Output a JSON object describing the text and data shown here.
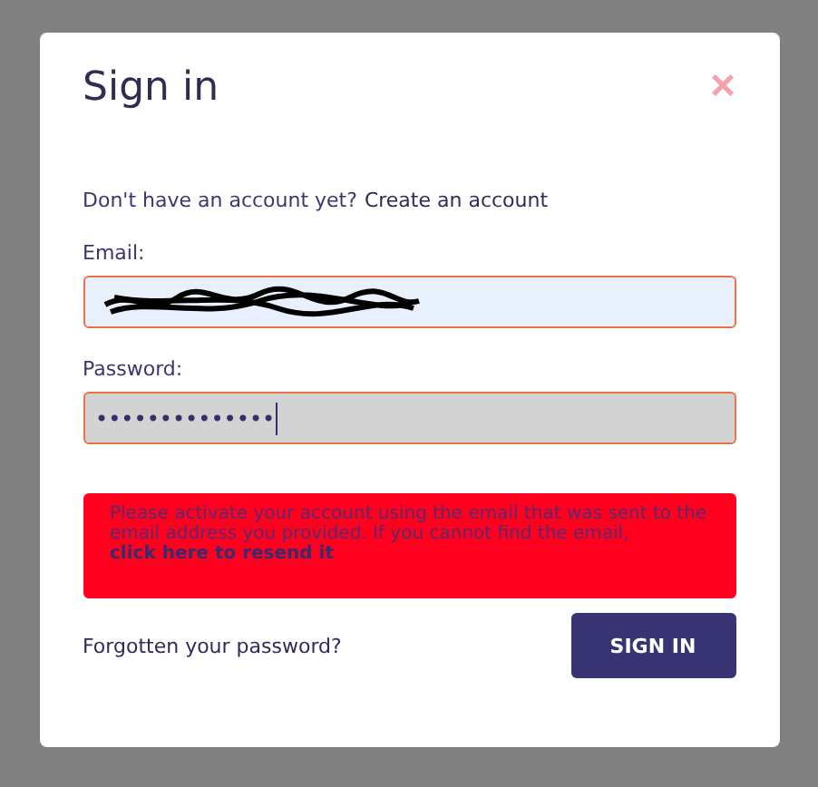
{
  "dialog": {
    "title": "Sign in",
    "close": "×"
  },
  "signup": {
    "prompt": "Don't have an account yet?",
    "link": "Create an account"
  },
  "email": {
    "label": "Email:",
    "redacted": true
  },
  "password": {
    "label": "Password:",
    "value": "••••••••••••••",
    "focused": true
  },
  "error": {
    "text": "Please activate your account using the email that was sent to the email address you provided. If you cannot find the email,",
    "link": "click here to resend it"
  },
  "forgot": "Forgotten your password?",
  "submit": "SIGN IN"
}
